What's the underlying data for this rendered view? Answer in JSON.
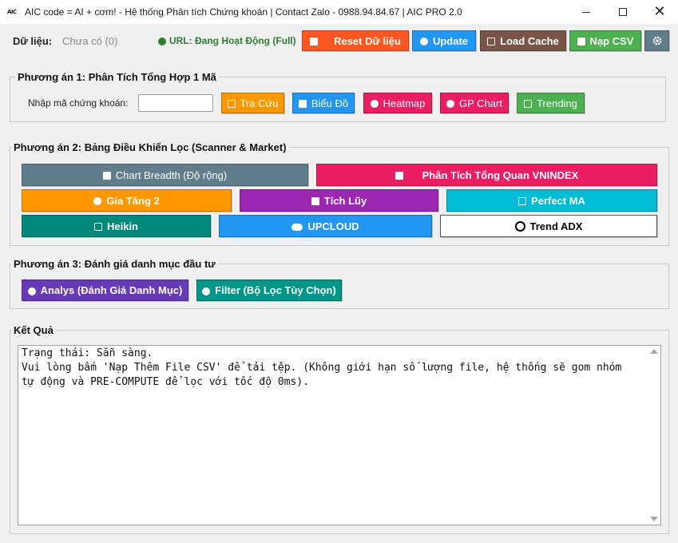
{
  "window": {
    "logo_text": "AIC",
    "title": "AIC code = AI + cơm! - Hệ thống Phân tích Chứng khoán | Contact Zalo - 0988.94.84.67 | AIC PRO 2.0"
  },
  "header": {
    "data_label": "Dữ liệu:",
    "data_value": "Chưa có (0)",
    "status": "URL: Đang Hoạt Động (Full)",
    "status_color": "#2e7d32",
    "buttons": {
      "reset": {
        "label": "Reset Dữ liệu",
        "icon": "trash-icon",
        "color": "#ff5722"
      },
      "update": {
        "label": "Update",
        "icon": "refresh-icon",
        "color": "#2196f3"
      },
      "load_cache": {
        "label": "Load Cache",
        "icon": "folder-icon",
        "color": "#795548"
      },
      "load_csv": {
        "label": "Nạp CSV",
        "icon": "upload-icon",
        "color": "#4caf50"
      },
      "settings": {
        "icon": "gear-icon",
        "color": "#607d8b"
      }
    }
  },
  "section1": {
    "title": "Phương án 1: Phân Tích Tổng Hợp 1 Mã",
    "input_label": "Nhập mã chứng khoán:",
    "input_value": "",
    "buttons": {
      "lookup": {
        "label": "Tra Cứu",
        "icon": "search-icon",
        "color": "#ff9800"
      },
      "chart": {
        "label": "Biểu Đồ",
        "icon": "chart-icon",
        "color": "#2196f3"
      },
      "heatmap": {
        "label": "Heatmap",
        "icon": "fire-icon",
        "color": "#e91e63"
      },
      "gp_chart": {
        "label": "GP Chart",
        "icon": "star-icon",
        "color": "#e91e63"
      },
      "trending": {
        "label": "Trending",
        "icon": "trend-icon",
        "color": "#4caf50"
      }
    }
  },
  "section2": {
    "title": "Phương án 2: Bảng Điều Khiển Lọc (Scanner & Market)",
    "buttons": {
      "chart_breadth": {
        "label": "Chart Breadth (Độ rộng)",
        "icon": "chart-icon",
        "color": "#607d8b"
      },
      "vnindex": {
        "label": "Phân Tích Tổng Quan VNINDEX",
        "icon": "bank-icon",
        "color": "#e91e63"
      },
      "gia_tang": {
        "label": "Gia Tăng 2",
        "icon": "rocket-icon",
        "color": "#ff9800"
      },
      "tich_luy": {
        "label": "Tích Lũy",
        "icon": "cube-icon",
        "color": "#9c27b0"
      },
      "perfect_ma": {
        "label": "Perfect MA",
        "icon": "check-icon",
        "color": "#00bcd4"
      },
      "heikin": {
        "label": "Heikin",
        "icon": "candle-icon",
        "color": "#00897b"
      },
      "upcloud": {
        "label": "UPCLOUD",
        "icon": "cloud-icon",
        "color": "#2196f3"
      },
      "trend_adx": {
        "label": "Trend ADX",
        "icon": "circle-icon",
        "color": "#ffffff"
      }
    }
  },
  "section3": {
    "title": "Phương án 3: Đánh giá danh mục đầu tư",
    "buttons": {
      "analys": {
        "label": "Analys (Đánh Giá Danh Mục)",
        "icon": "magnifier-icon",
        "color": "#673ab7"
      },
      "filter": {
        "label": "Filter (Bộ Lọc Tùy Chọn)",
        "icon": "magnifier-icon",
        "color": "#009688"
      }
    }
  },
  "results": {
    "title": "Kết Quả",
    "text": "Trạng thái: Sẵn sàng.\nVui lòng bấm 'Nạp Thêm File CSV' để tải tệp. (Không giới hạn số lượng file, hệ thống sẽ gom nhóm\ntự động và PRE-COMPUTE để lọc với tốc độ 0ms)."
  }
}
